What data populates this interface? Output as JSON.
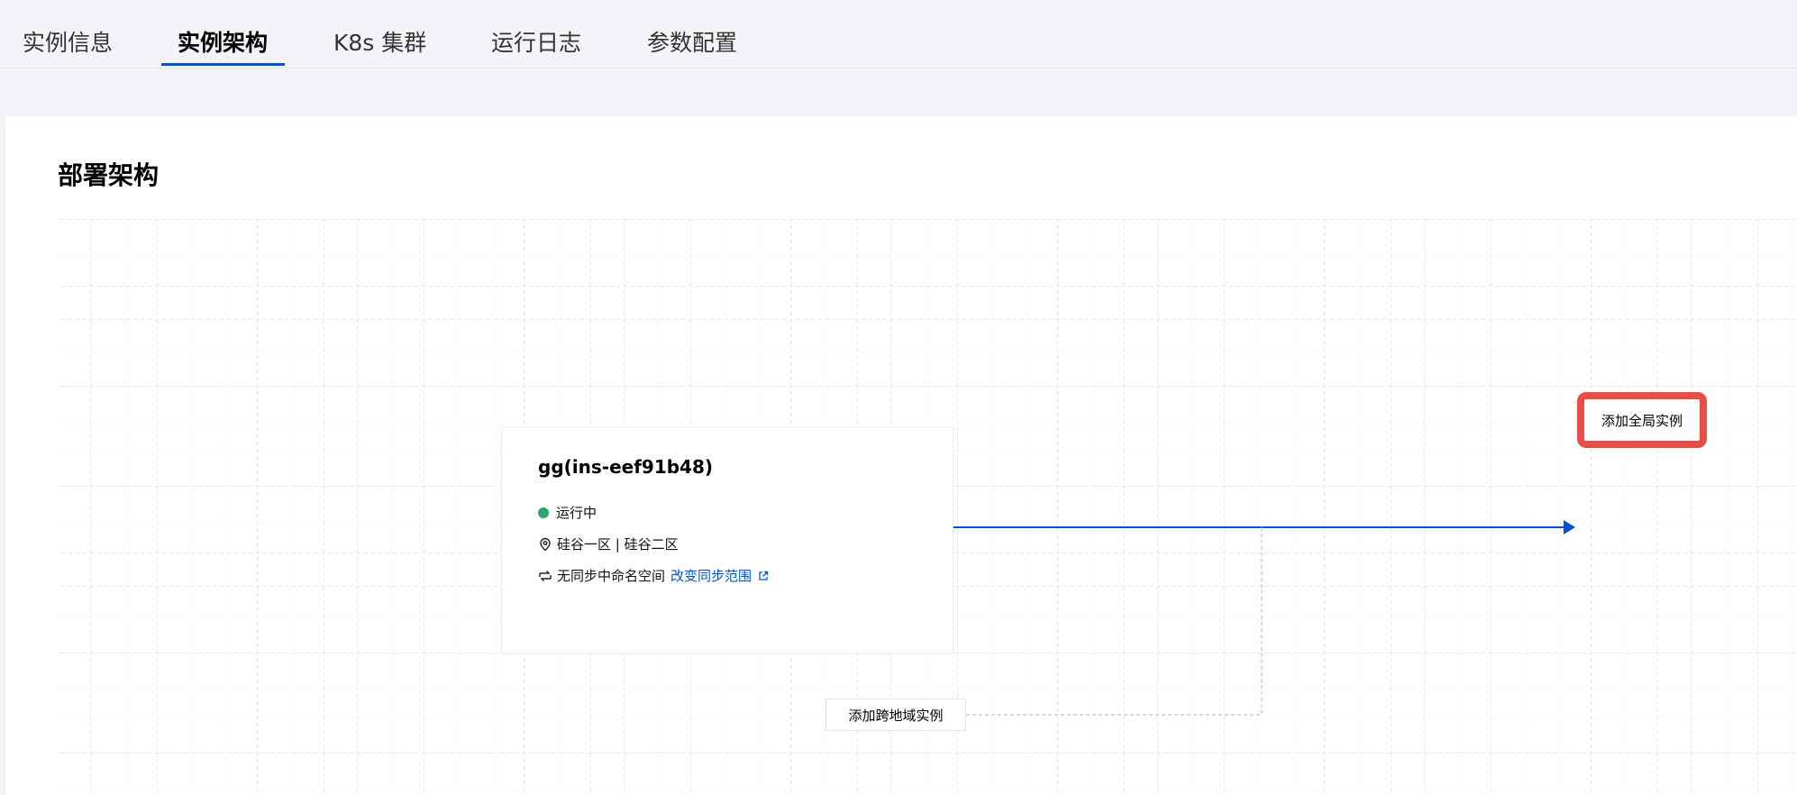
{
  "tabs": [
    {
      "label": "实例信息"
    },
    {
      "label": "实例架构"
    },
    {
      "label": "K8s 集群"
    },
    {
      "label": "运行日志"
    },
    {
      "label": "参数配置"
    }
  ],
  "active_tab": "实例架构",
  "section": {
    "title": "部署架构"
  },
  "instance_card": {
    "title": "gg(ins-eef91b48)",
    "status": "运行中",
    "status_color": "#2ba471",
    "location": "硅谷一区 | 硅谷二区",
    "sync_text": "无同步中命名空间",
    "sync_link": "改变同步范围"
  },
  "buttons": {
    "add_global": "添加全局实例",
    "add_cross_region": "添加跨地域实例"
  },
  "colors": {
    "accent": "#0052d9",
    "highlight": "#ea4c46"
  }
}
